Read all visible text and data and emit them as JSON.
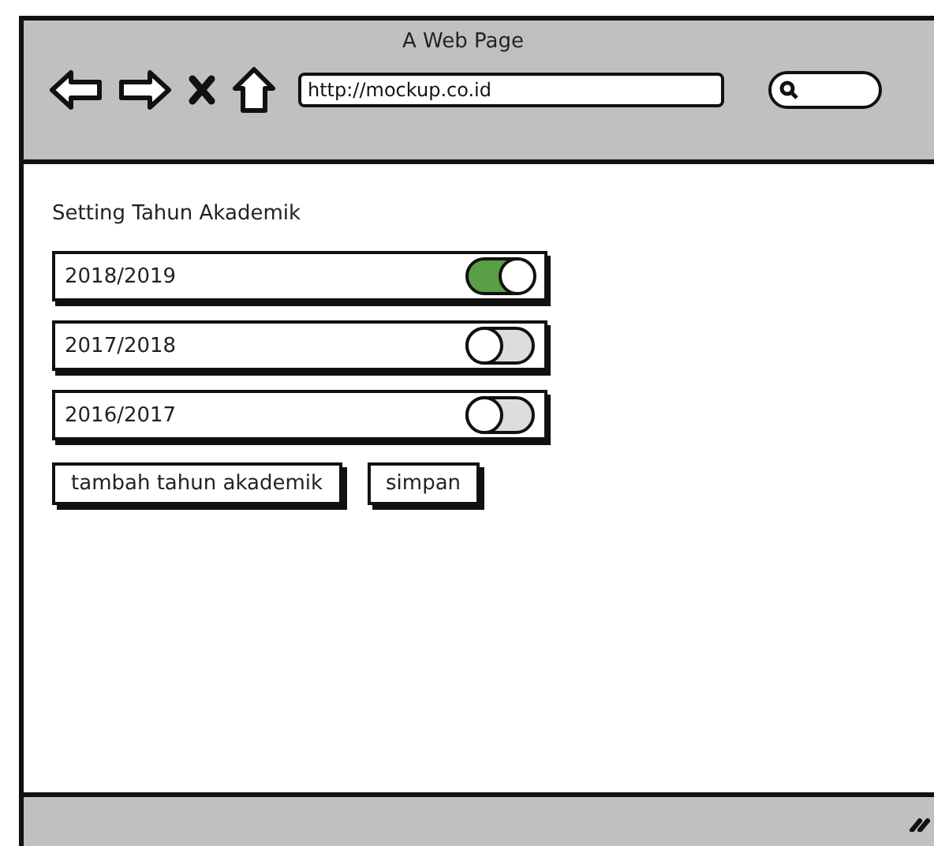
{
  "window": {
    "title": "A Web Page"
  },
  "toolbar": {
    "url": "http://mockup.co.id"
  },
  "page": {
    "heading": "Setting Tahun Akademik",
    "years": [
      {
        "label": "2018/2019",
        "on": true
      },
      {
        "label": "2017/2018",
        "on": false
      },
      {
        "label": "2016/2017",
        "on": false
      }
    ],
    "buttons": [
      "tambah tahun akademik",
      "simpan"
    ]
  }
}
